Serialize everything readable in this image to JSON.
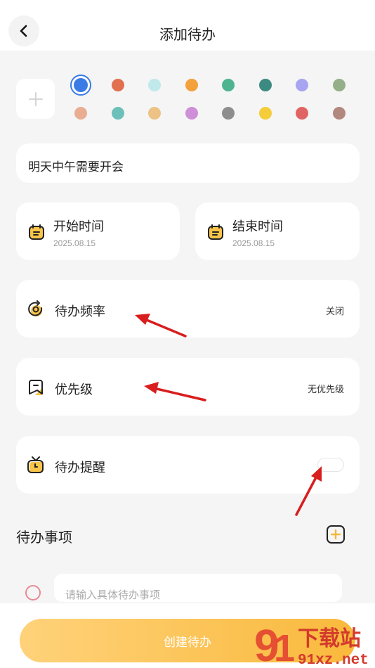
{
  "header": {
    "title": "添加待办",
    "back_icon": "chevron-left-icon"
  },
  "colors": {
    "selected": "#3a7be6",
    "row1": [
      "#3a7be6",
      "#e0704f",
      "#bfe9ea",
      "#f4a03c",
      "#4db48f",
      "#3d8a82",
      "#a7a5f2",
      "#95b088"
    ],
    "row2": [
      "#e9ad92",
      "#6cc0b9",
      "#edc285",
      "#cf8fd8",
      "#8e8e8e",
      "#f5cd3b",
      "#e16464",
      "#b1877e"
    ]
  },
  "todo_title": "明天中午需要开会",
  "start_time": {
    "label": "开始时间",
    "date": "2025.08.15"
  },
  "end_time": {
    "label": "结束时间",
    "date": "2025.08.15"
  },
  "frequency": {
    "label": "待办频率",
    "value": "关闭"
  },
  "priority": {
    "label": "优先级",
    "value": "无优先级"
  },
  "reminder": {
    "label": "待办提醒",
    "enabled": false
  },
  "items_section": {
    "title": "待办事项",
    "placeholder": "请输入具体待办事项"
  },
  "create_button": "创建待办",
  "watermark": {
    "main": "下载站",
    "url": "91xz.net"
  }
}
